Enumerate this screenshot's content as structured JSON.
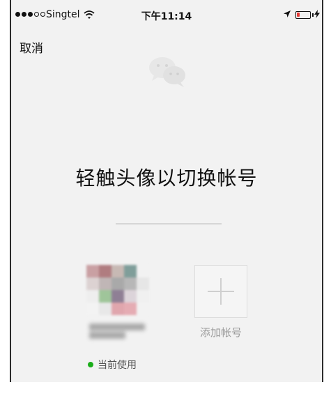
{
  "status_bar": {
    "carrier": "Singtel",
    "time": "下午11:14",
    "signal_icon": "signal-dots",
    "wifi_icon": "wifi-icon",
    "location_icon": "location-arrow-icon",
    "battery_icon": "battery-icon",
    "battery_color": "#e53935"
  },
  "nav": {
    "cancel_label": "取消"
  },
  "logo": {
    "icon": "wechat-logo-icon"
  },
  "main": {
    "title": "轻触头像以切换帐号"
  },
  "accounts": {
    "current": {
      "status_label": "当前使用",
      "status_color": "#1aad19"
    },
    "add": {
      "label": "添加帐号",
      "icon": "plus-icon"
    }
  }
}
